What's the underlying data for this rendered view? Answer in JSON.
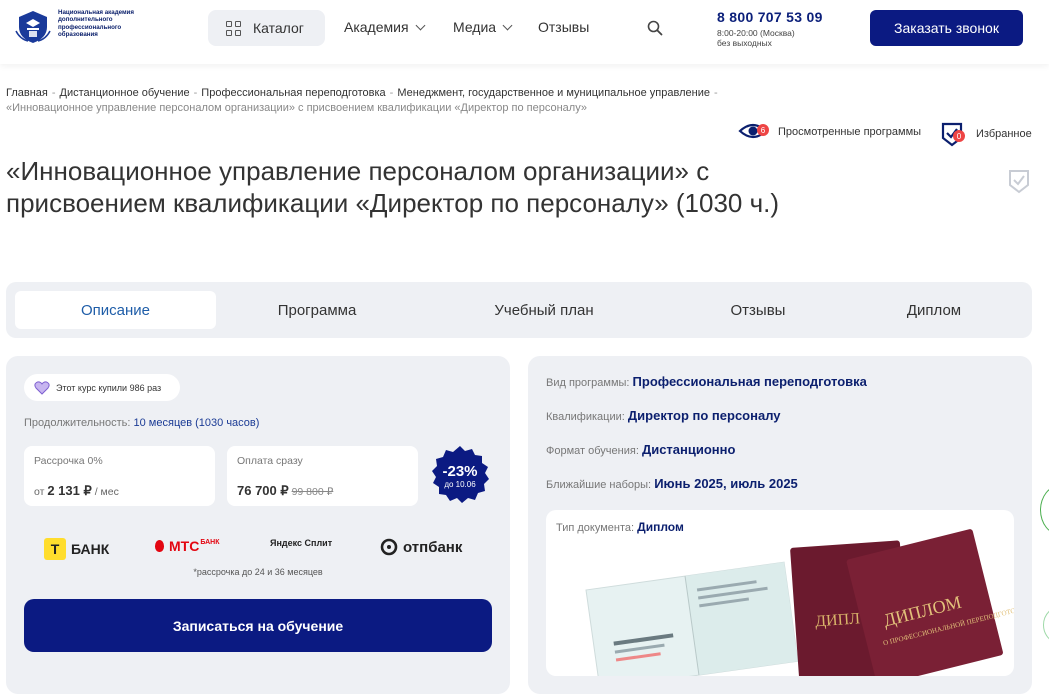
{
  "header": {
    "logo_text": "Национальная академия дополнительного профессионального образования",
    "catalog_label": "Каталог",
    "nav": [
      {
        "label": "Академия",
        "has_dropdown": true
      },
      {
        "label": "Медиа",
        "has_dropdown": true
      },
      {
        "label": "Отзывы",
        "has_dropdown": false
      }
    ],
    "phone": "8 800 707 53 09",
    "phone_hours": "8:00-20:00 (Москва)",
    "phone_days": "без выходных",
    "callback_label": "Заказать звонок"
  },
  "breadcrumb": [
    "Главная",
    "Дистанционное обучение",
    "Профессиональная переподготовка",
    "Менеджмент, государственное и муниципальное управление",
    "«Инновационное управление персоналом организации» с присвоением квалификации «Директор по персоналу»"
  ],
  "utility": {
    "viewed_label": "Просмотренные программы",
    "viewed_count": "6",
    "favorites_label": "Избранное",
    "favorites_count": "0"
  },
  "title": "«Инновационное управление персоналом организации» с присвоением квалификации «Директор по персоналу» (1030 ч.)",
  "tabs": [
    {
      "label": "Описание",
      "active": true
    },
    {
      "label": "Программа",
      "active": false
    },
    {
      "label": "Учебный план",
      "active": false
    },
    {
      "label": "Отзывы",
      "active": false
    },
    {
      "label": "Диплом",
      "active": false
    }
  ],
  "purchase": {
    "bought_text": "Этот курс купили 986 раз",
    "duration_label": "Продолжительность:",
    "duration_value": "10 месяцев (1030 часов)",
    "installment_label": "Рассрочка 0%",
    "installment_prefix": "от",
    "installment_amount": "2 131 ₽",
    "installment_suffix": "/ мес",
    "full_label": "Оплата сразу",
    "full_price": "76 700 ₽",
    "old_price": "99 800 ₽",
    "discount": "-23%",
    "discount_until": "до 10.06",
    "banks": [
      "БАНК",
      "МТС",
      "Яндекс Сплит",
      "отпбанк"
    ],
    "mts_sub": "БАНК",
    "installment_note": "*рассрочка до 24 и 36 месяцев",
    "enroll_label": "Записаться на обучение"
  },
  "program_info": {
    "rows": [
      {
        "label": "Вид программы:",
        "value": "Профессиональная переподготовка"
      },
      {
        "label": "Квалификации:",
        "value": "Директор по персоналу"
      },
      {
        "label": "Формат обучения:",
        "value": "Дистанционно"
      },
      {
        "label": "Ближайшие наборы:",
        "value": "Июнь 2025, июль 2025"
      }
    ],
    "doc_label": "Тип документа:",
    "doc_value": "Диплом",
    "diploma_word": "ДИПЛОМ",
    "diploma_sub": "О ПРОФЕССИОНАЛЬНОЙ ПЕРЕПОДГОТОВКЕ"
  },
  "colors": {
    "brand": "#0b1a82",
    "accent_blue": "#1e5da8",
    "panel_bg": "#eef0f4",
    "diploma_red": "#7a2035"
  }
}
